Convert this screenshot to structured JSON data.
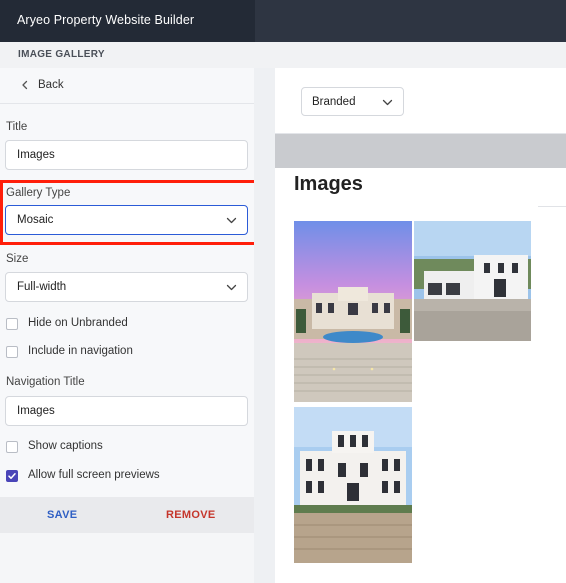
{
  "app": {
    "title": "Aryeo Property Website Builder"
  },
  "section": {
    "label": "IMAGE GALLERY"
  },
  "sidebar": {
    "back_label": "Back",
    "title_label": "Title",
    "title_value": "Images",
    "gallery_type_label": "Gallery Type",
    "gallery_type_value": "Mosaic",
    "size_label": "Size",
    "size_value": "Full-width",
    "hide_unbranded_label": "Hide on Unbranded",
    "hide_unbranded_checked": false,
    "include_nav_label": "Include in navigation",
    "include_nav_checked": false,
    "nav_title_label": "Navigation Title",
    "nav_title_value": "Images",
    "show_captions_label": "Show captions",
    "show_captions_checked": false,
    "full_screen_label": "Allow full screen previews",
    "full_screen_checked": true,
    "save_label": "SAVE",
    "remove_label": "REMOVE"
  },
  "preview": {
    "mode_value": "Branded",
    "gallery_title": "Images"
  },
  "colors": {
    "header_bg": "#232a36",
    "accent_blue": "#2f5fc4",
    "remove_red": "#c5362c",
    "highlight": "#ff1e0a",
    "checkbox_checked": "#4a45b8"
  }
}
